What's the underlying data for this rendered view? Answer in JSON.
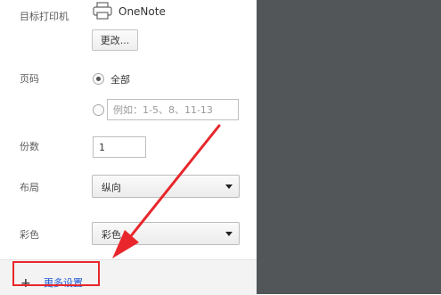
{
  "print": {
    "destination": {
      "label": "目标打印机",
      "printer_name": "OneNote",
      "change_button": "更改..."
    },
    "pages": {
      "label": "页码",
      "all_label": "全部",
      "all_selected": true,
      "custom_placeholder": "例如：1-5、8、11-13"
    },
    "copies": {
      "label": "份数",
      "value": "1"
    },
    "layout": {
      "label": "布局",
      "value": "纵向"
    },
    "color": {
      "label": "彩色",
      "value": "彩色"
    },
    "more_settings": {
      "label": "更多设置"
    }
  },
  "annotation": {
    "color": "#e8262b"
  },
  "preview": {
    "background": "#525659"
  }
}
